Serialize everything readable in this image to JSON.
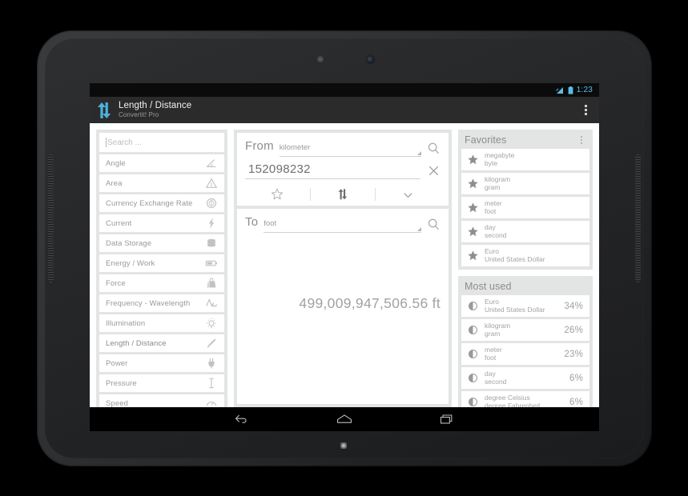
{
  "device": {
    "type": "android-tablet",
    "bezel_color": "#2b2c2e"
  },
  "status_bar": {
    "clock": "1:23",
    "icons": [
      "signal-icon",
      "battery-icon"
    ],
    "accent_color": "#5bbde4"
  },
  "action_bar": {
    "app_icon": "convert-arrows-icon",
    "title": "Length / Distance",
    "subtitle": "Convertit! Pro",
    "overflow_label": "overflow-menu",
    "background": "#2b2b2b",
    "icon_color": "#4db2e0"
  },
  "sidebar": {
    "search": {
      "placeholder": "Search ...",
      "value": ""
    },
    "items": [
      {
        "label": "Angle",
        "icon": "angle-icon"
      },
      {
        "label": "Area",
        "icon": "triangle-area-icon"
      },
      {
        "label": "Currency Exchange Rate",
        "icon": "currency-coin-icon"
      },
      {
        "label": "Current",
        "icon": "lightning-bolt-icon"
      },
      {
        "label": "Data Storage",
        "icon": "database-icon"
      },
      {
        "label": "Energy / Work",
        "icon": "battery-energy-icon"
      },
      {
        "label": "Force",
        "icon": "weight-icon"
      },
      {
        "label": "Frequency - Wavelength",
        "icon": "wave-icon"
      },
      {
        "label": "Illumination",
        "icon": "lightbulb-icon"
      },
      {
        "label": "Length / Distance",
        "icon": "ruler-pencil-icon"
      },
      {
        "label": "Power",
        "icon": "power-plug-icon"
      },
      {
        "label": "Pressure",
        "icon": "pressure-gauge-icon"
      },
      {
        "label": "Speed",
        "icon": "speed-icon"
      }
    ],
    "selected_index": 9
  },
  "converter": {
    "from": {
      "label": "From",
      "unit": "kilometer",
      "value": "152098232",
      "search_icon": "search-icon",
      "clear_icon": "close-icon",
      "spinner_icon": "dropdown-caret-icon"
    },
    "actions": [
      {
        "name": "favorite",
        "icon": "star-outline-icon"
      },
      {
        "name": "swap",
        "icon": "swap-vertical-icon"
      },
      {
        "name": "expand",
        "icon": "chevron-down-icon"
      }
    ],
    "to": {
      "label": "To",
      "unit": "foot",
      "search_icon": "search-icon",
      "spinner_icon": "dropdown-caret-icon"
    },
    "result": "499,009,947,506.56 ft"
  },
  "favorites": {
    "title": "Favorites",
    "overflow_label": "overflow-menu",
    "items": [
      {
        "from": "megabyte",
        "to": "byte",
        "icon": "star-filled-icon"
      },
      {
        "from": "kilogram",
        "to": "gram",
        "icon": "star-filled-icon"
      },
      {
        "from": "meter",
        "to": "foot",
        "icon": "star-filled-icon"
      },
      {
        "from": "day",
        "to": "second",
        "icon": "star-filled-icon"
      },
      {
        "from": "Euro",
        "to": "United States Dollar",
        "icon": "star-filled-icon"
      }
    ]
  },
  "most_used": {
    "title": "Most used",
    "items": [
      {
        "from": "Euro",
        "to": "United States Dollar",
        "percent": "34%",
        "icon": "pie-chart-icon"
      },
      {
        "from": "kilogram",
        "to": "gram",
        "percent": "26%",
        "icon": "pie-chart-icon"
      },
      {
        "from": "meter",
        "to": "foot",
        "percent": "23%",
        "icon": "pie-chart-icon"
      },
      {
        "from": "day",
        "to": "second",
        "percent": "6%",
        "icon": "pie-chart-icon"
      },
      {
        "from": "degree Celsius",
        "to": "degree Fahrenheit",
        "percent": "6%",
        "icon": "pie-chart-icon"
      }
    ]
  },
  "nav_bar": {
    "buttons": [
      {
        "name": "back",
        "icon": "back-arrow-icon"
      },
      {
        "name": "home",
        "icon": "home-icon"
      },
      {
        "name": "recents",
        "icon": "recents-icon"
      }
    ]
  }
}
